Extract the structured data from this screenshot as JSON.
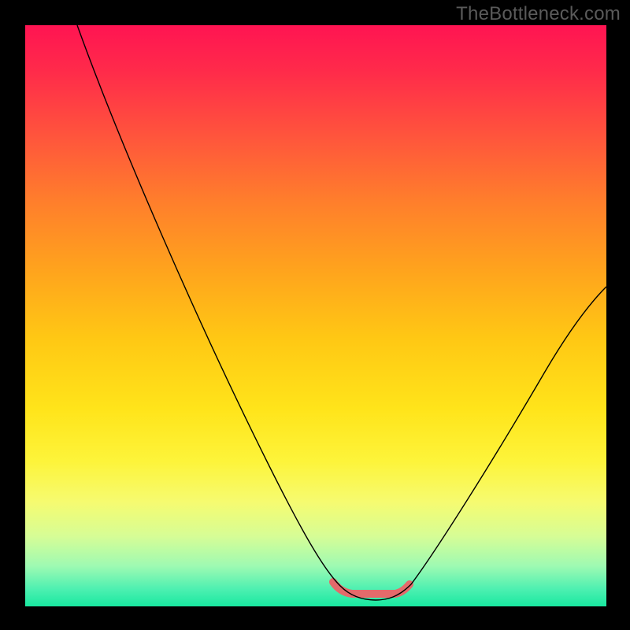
{
  "watermark": "TheBottleneck.com",
  "chart_data": {
    "type": "line",
    "title": "",
    "xlabel": "",
    "ylabel": "",
    "xlim": [
      0,
      100
    ],
    "ylim": [
      0,
      100
    ],
    "background": "red-to-green vertical gradient (high = red, low = green)",
    "series": [
      {
        "name": "bottleneck-curve",
        "x": [
          9,
          15,
          20,
          25,
          30,
          35,
          40,
          45,
          50,
          53,
          55,
          57,
          59,
          62,
          65,
          70,
          75,
          80,
          85,
          90,
          95,
          100
        ],
        "y": [
          100,
          89,
          80,
          71,
          62,
          53,
          44,
          34,
          22,
          13,
          7,
          3,
          1.5,
          1.5,
          3,
          8,
          15,
          23,
          31,
          39,
          47,
          55
        ]
      }
    ],
    "optimal_zone": {
      "x_start": 53,
      "x_end": 65,
      "y": 2
    },
    "colors": {
      "curve": "#000000",
      "optimal_highlight": "#e46a6b",
      "gradient_top": "#ff1452",
      "gradient_bottom": "#18e8a0"
    }
  }
}
